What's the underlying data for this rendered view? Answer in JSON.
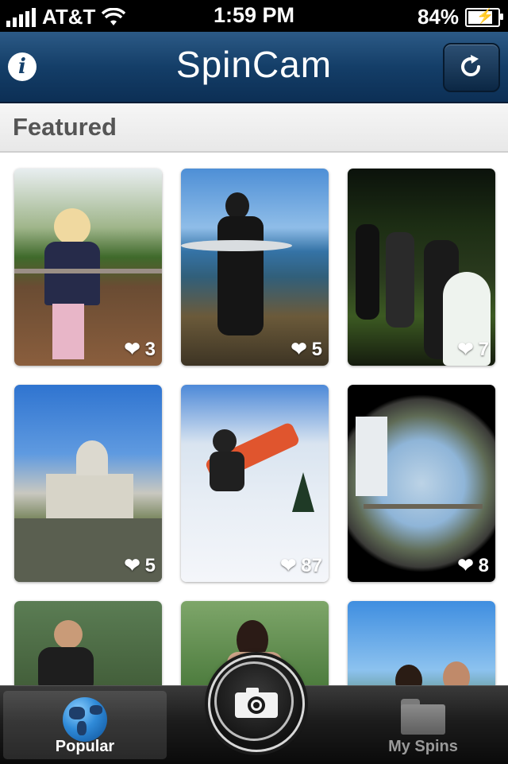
{
  "status_bar": {
    "carrier": "AT&T",
    "time": "1:59 PM",
    "battery_percent": "84%",
    "battery_level": 0.84
  },
  "nav": {
    "title": "SpinCam",
    "info_icon": "i"
  },
  "section": {
    "title": "Featured"
  },
  "tiles": [
    {
      "likes": "3"
    },
    {
      "likes": "5"
    },
    {
      "likes": "7"
    },
    {
      "likes": "5"
    },
    {
      "likes": "87"
    },
    {
      "likes": "8"
    },
    {
      "likes": ""
    },
    {
      "likes": ""
    },
    {
      "likes": ""
    }
  ],
  "tab_bar": {
    "popular_label": "Popular",
    "my_spins_label": "My Spins",
    "selected": "Popular"
  },
  "colors": {
    "nav_bar": "#143e68",
    "tab_bar": "#1c1c1c",
    "section_header_text": "#555555"
  }
}
